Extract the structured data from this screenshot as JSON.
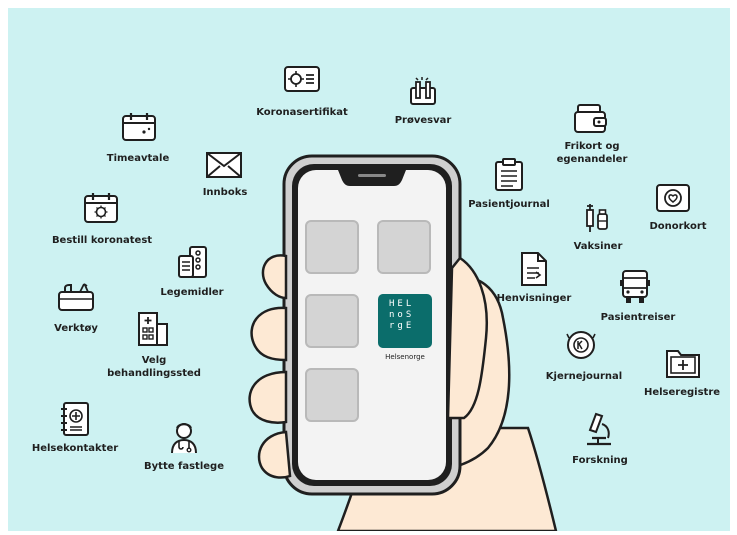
{
  "labels": {
    "koronasertifikat": "Koronasertifikat",
    "provesvar": "Prøvesvar",
    "timeavtale": "Timeavtale",
    "innboks": "Innboks",
    "frikort": "Frikort og\negenandeler",
    "pasientjournal": "Pasientjournal",
    "donorkort": "Donorkort",
    "bestill_koronatest": "Bestill koronatest",
    "vaksiner": "Vaksiner",
    "legemidler": "Legemidler",
    "henvisninger": "Henvisninger",
    "pasientreiser": "Pasientreiser",
    "verktoy": "Verktøy",
    "velg_behandlingssted": "Velg\nbehandlingssted",
    "kjernejournal": "Kjernejournal",
    "helseregistre": "Helseregistre",
    "helsekontakter": "Helsekontakter",
    "bytte_fastlege": "Bytte fastlege",
    "forskning": "Forskning"
  },
  "app_logo": {
    "lines": [
      "HEL",
      "noS",
      "rgE"
    ],
    "caption": "Helsenorge"
  },
  "colors": {
    "background": "#cdf2f2",
    "logo": "#0b6d6b",
    "skin": "#fde9d4",
    "outline": "#1f1f1f"
  }
}
